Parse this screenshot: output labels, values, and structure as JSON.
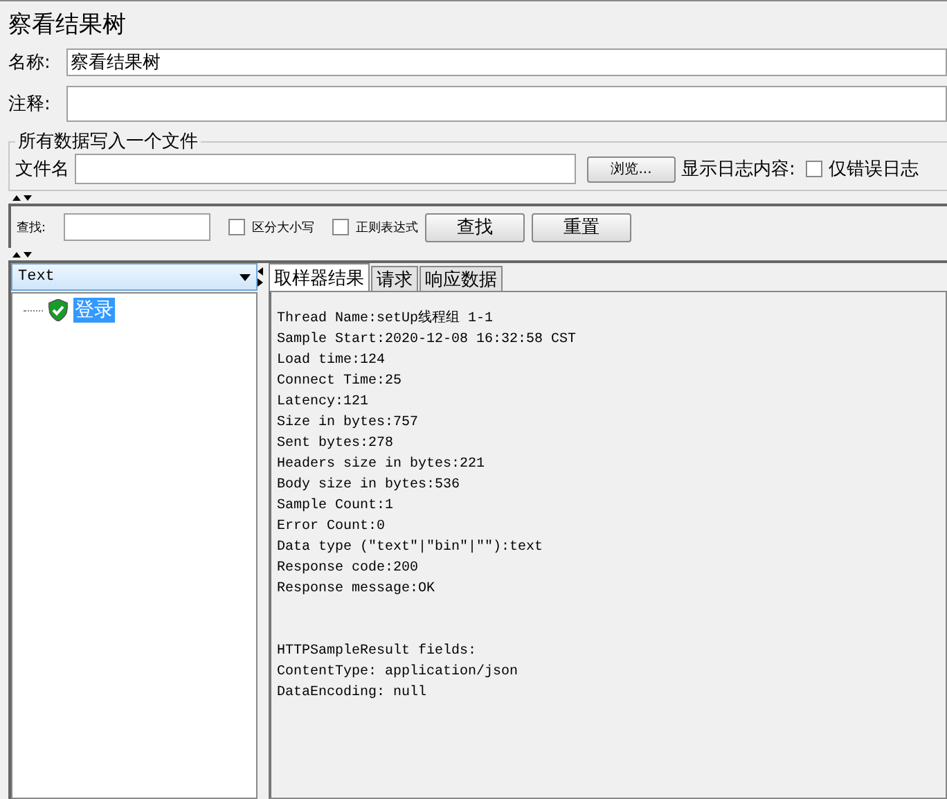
{
  "window": {
    "title": "察看结果树"
  },
  "name_field": {
    "label": "名称:",
    "value": "察看结果树"
  },
  "comment_field": {
    "label": "注释:"
  },
  "file_group": {
    "title": "所有数据写入一个文件",
    "file_label": "文件名",
    "browse_button": "浏览...",
    "log_label": "显示日志内容:",
    "errors_only": {
      "label": "仅错误日志",
      "checked": false
    }
  },
  "search_bar": {
    "label": "查找:",
    "case_sensitive": {
      "label": "区分大小写",
      "checked": false
    },
    "regex": {
      "label": "正则表达式",
      "checked": false
    },
    "find_button": "查找",
    "reset_button": "重置"
  },
  "renderer_select": {
    "value": "Text"
  },
  "tree": [
    {
      "label": "登录",
      "selected": true
    }
  ],
  "tabs": [
    {
      "label": "取样器结果",
      "selected": true
    },
    {
      "label": "请求",
      "selected": false
    },
    {
      "label": "响应数据",
      "selected": false
    }
  ],
  "result_lines": [
    "Thread Name:setUp线程组 1-1",
    "Sample Start:2020-12-08 16:32:58 CST",
    "Load time:124",
    "Connect Time:25",
    "Latency:121",
    "Size in bytes:757",
    "Sent bytes:278",
    "Headers size in bytes:221",
    "Body size in bytes:536",
    "Sample Count:1",
    "Error Count:0",
    "Data type (\"text\"|\"bin\"|\"\"):text",
    "Response code:200",
    "Response message:OK"
  ],
  "result_fields": [
    "HTTPSampleResult fields:",
    "ContentType: application/json",
    "DataEncoding: null"
  ]
}
